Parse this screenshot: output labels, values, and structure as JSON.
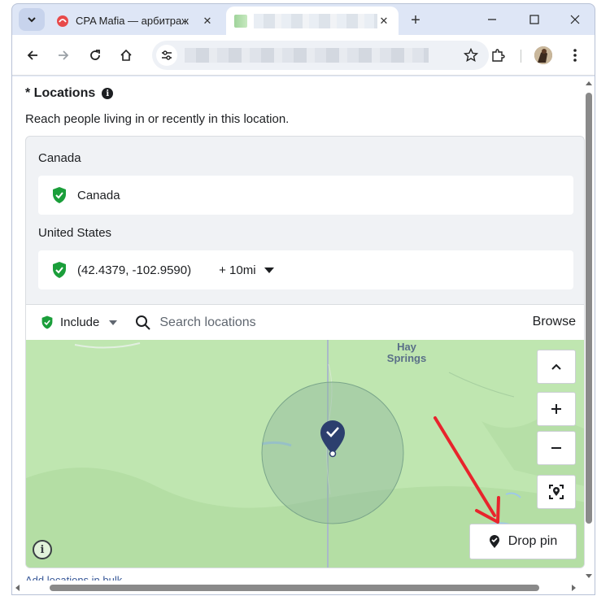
{
  "browser": {
    "tabs": [
      {
        "title": "CPA Mafia — арбитраж",
        "active": false
      },
      {
        "title": "",
        "active": true
      }
    ],
    "new_tab": "+"
  },
  "page": {
    "section_title": "* Locations",
    "subtitle": "Reach people living in or recently in this location.",
    "groups": [
      {
        "label": "Canada",
        "items": [
          {
            "text": "Canada"
          }
        ]
      },
      {
        "label": "United States",
        "items": [
          {
            "text": "(42.4379, -102.9590)",
            "radius": "+ 10mi"
          }
        ]
      }
    ],
    "search": {
      "include_label": "Include",
      "placeholder": "Search locations",
      "browse_label": "Browse"
    },
    "map": {
      "place_label": "Hay Springs",
      "drop_pin_label": "Drop pin"
    },
    "bulk_link": "Add locations in bulk"
  },
  "colors": {
    "included_green": "#1a9e3a",
    "pin_navy": "#2c3f6e",
    "annotation_red": "#e8242c",
    "map_green": "#bfe6b0"
  }
}
